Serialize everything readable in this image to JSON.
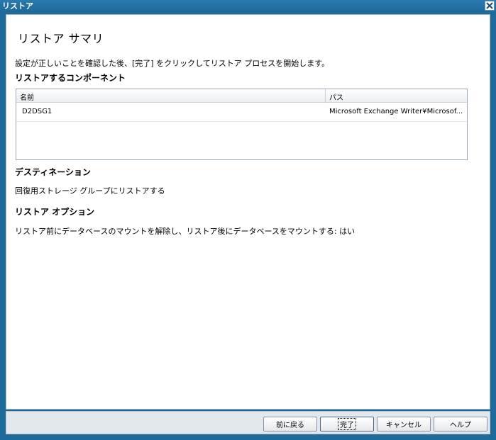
{
  "window": {
    "title": "リストア"
  },
  "page": {
    "title": "リストア サマリ",
    "intro": "設定が正しいことを確認した後、[完了] をクリックしてリストア プロセスを開始します。"
  },
  "components": {
    "heading": "リストアするコンポーネント",
    "columns": [
      "名前",
      "パス"
    ],
    "rows": [
      {
        "name": "D2DSG1",
        "path": "Microsoft Exchange Writer¥Microsof..."
      }
    ]
  },
  "destination": {
    "heading": "デスティネーション",
    "value": "回復用ストレージ グループにリストアする"
  },
  "options": {
    "heading": "リストア オプション",
    "value": "リストア前にデータベースのマウントを解除し、リストア後にデータベースをマウントする: はい"
  },
  "buttons": {
    "back": "前に戻る",
    "finish": "完了",
    "cancel": "キャンセル",
    "help": "ヘルプ"
  },
  "colors": {
    "frame": "#1e6a99",
    "content_bg": "#ffffff",
    "footer_bg": "#e3e8ef"
  },
  "icons": {
    "close": "close-icon"
  }
}
